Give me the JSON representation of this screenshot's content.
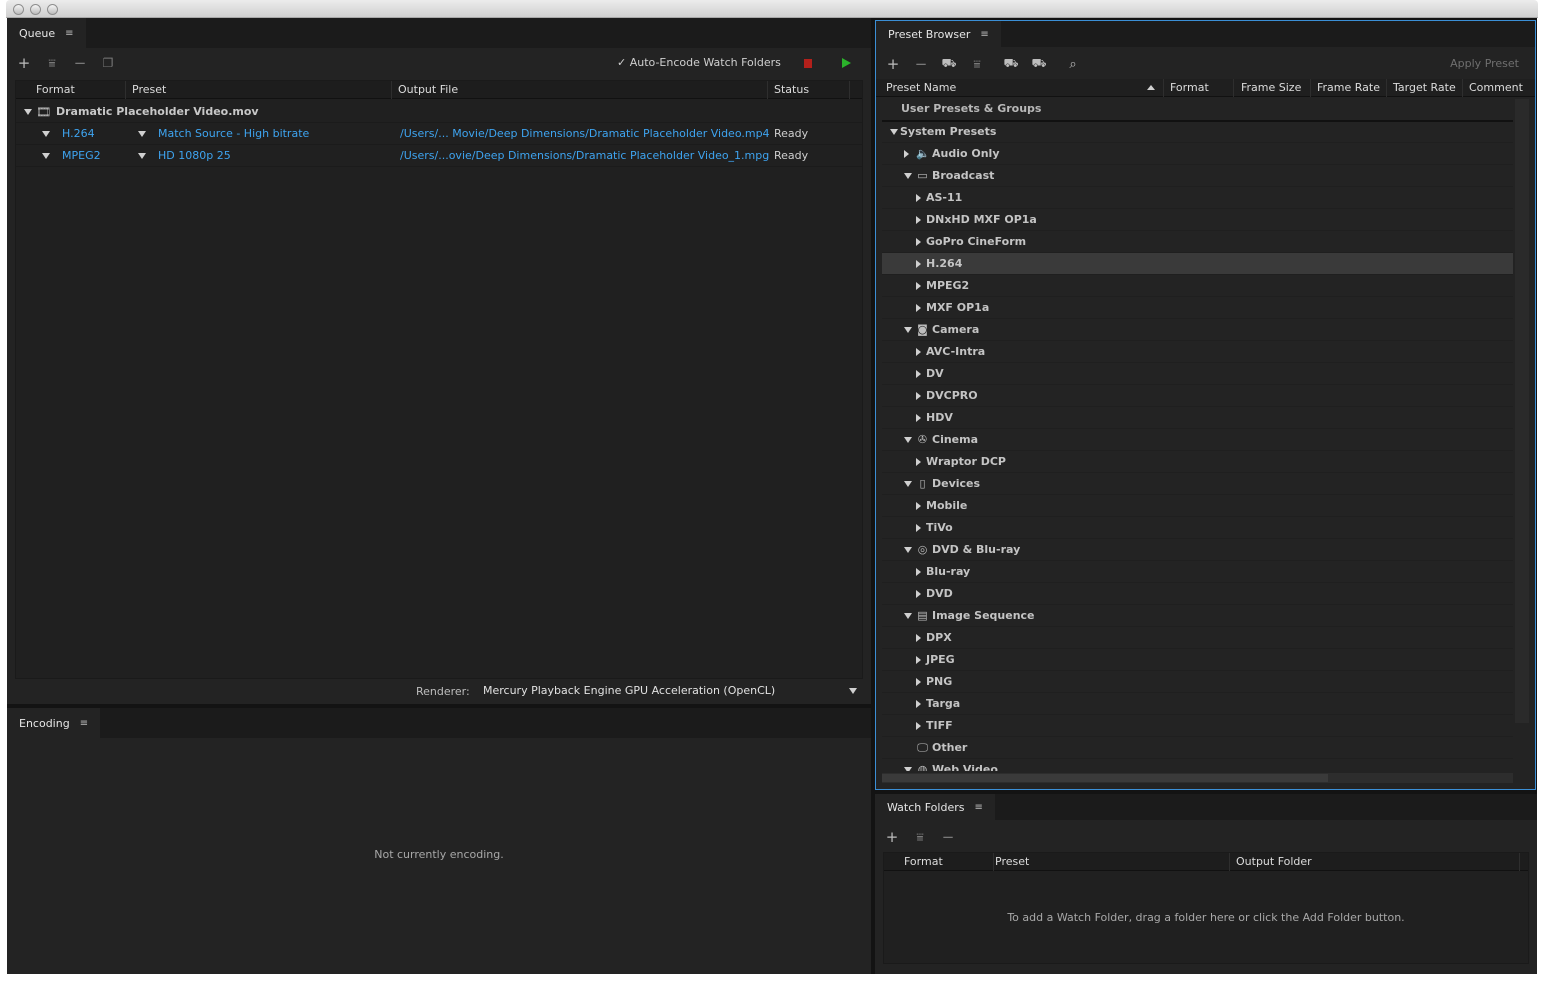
{
  "queue": {
    "tab_label": "Queue",
    "auto_encode_label": "✓ Auto-Encode Watch Folders",
    "columns": [
      "Format",
      "Preset",
      "Output File",
      "Status"
    ],
    "source_file": "Dramatic Placeholder Video.mov",
    "items": [
      {
        "format": "H.264",
        "preset": "Match Source - High bitrate",
        "output": "/Users/... Movie/Deep Dimensions/Dramatic Placeholder Video.mp4",
        "status": "Ready"
      },
      {
        "format": "MPEG2",
        "preset": "HD 1080p 25",
        "output": "/Users/...ovie/Deep Dimensions/Dramatic Placeholder Video_1.mpg",
        "status": "Ready"
      }
    ],
    "renderer_label": "Renderer:",
    "renderer_value": "Mercury Playback Engine GPU Acceleration (OpenCL)"
  },
  "encoding": {
    "tab_label": "Encoding",
    "status_text": "Not currently encoding."
  },
  "preset_browser": {
    "tab_label": "Preset Browser",
    "apply_label": "Apply Preset",
    "columns": [
      "Preset Name",
      "Format",
      "Frame Size",
      "Frame Rate",
      "Target Rate",
      "Comment"
    ],
    "user_presets": "User Presets & Groups",
    "system_presets": "System Presets",
    "tree": [
      {
        "label": "Audio Only",
        "level": 1,
        "expanded": false,
        "icon": "speaker-icon"
      },
      {
        "label": "Broadcast",
        "level": 1,
        "expanded": true,
        "icon": "tv-icon"
      },
      {
        "label": "AS-11",
        "level": 2
      },
      {
        "label": "DNxHD MXF OP1a",
        "level": 2
      },
      {
        "label": "GoPro CineForm",
        "level": 2
      },
      {
        "label": "H.264",
        "level": 2,
        "selected": true
      },
      {
        "label": "MPEG2",
        "level": 2
      },
      {
        "label": "MXF OP1a",
        "level": 2
      },
      {
        "label": "Camera",
        "level": 1,
        "expanded": true,
        "icon": "camera-icon"
      },
      {
        "label": "AVC-Intra",
        "level": 2
      },
      {
        "label": "DV",
        "level": 2
      },
      {
        "label": "DVCPRO",
        "level": 2
      },
      {
        "label": "HDV",
        "level": 2
      },
      {
        "label": "Cinema",
        "level": 1,
        "expanded": true,
        "icon": "film-reel-icon"
      },
      {
        "label": "Wraptor DCP",
        "level": 2
      },
      {
        "label": "Devices",
        "level": 1,
        "expanded": true,
        "icon": "phone-icon"
      },
      {
        "label": "Mobile",
        "level": 2
      },
      {
        "label": "TiVo",
        "level": 2
      },
      {
        "label": "DVD & Blu-ray",
        "level": 1,
        "expanded": true,
        "icon": "disc-icon"
      },
      {
        "label": "Blu-ray",
        "level": 2
      },
      {
        "label": "DVD",
        "level": 2
      },
      {
        "label": "Image Sequence",
        "level": 1,
        "expanded": true,
        "icon": "filmstrip-icon"
      },
      {
        "label": "DPX",
        "level": 2
      },
      {
        "label": "JPEG",
        "level": 2
      },
      {
        "label": "PNG",
        "level": 2
      },
      {
        "label": "Targa",
        "level": 2
      },
      {
        "label": "TIFF",
        "level": 2
      },
      {
        "label": "Other",
        "level": 1,
        "icon": "monitor-icon"
      },
      {
        "label": "Web Video",
        "level": 1,
        "expanded": true,
        "icon": "globe-icon"
      }
    ]
  },
  "watch_folders": {
    "tab_label": "Watch Folders",
    "columns": [
      "Format",
      "Preset",
      "Output Folder"
    ],
    "empty_text": "To add a Watch Folder, drag a folder here or click the Add Folder button."
  },
  "colors": {
    "accent": "#3ea4f0",
    "stop": "#b3201b",
    "play": "#2bb32b",
    "focus_border": "#3b8fd6"
  }
}
